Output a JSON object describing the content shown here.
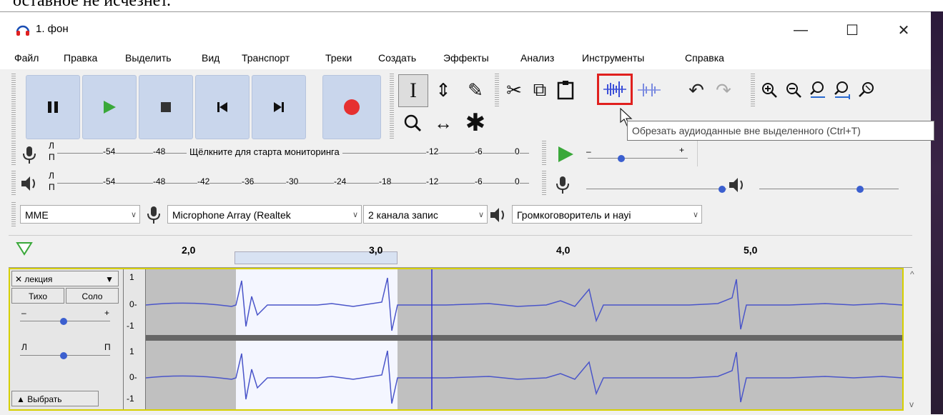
{
  "top_strip_text": "оставное не исчезнет.",
  "window": {
    "title": "1. фон",
    "minimize": "—",
    "maximize": "☐",
    "close": "✕"
  },
  "menu": [
    "Файл",
    "Правка",
    "Выделить",
    "Вид",
    "Транспорт",
    "Треки",
    "Создать",
    "Эффекты",
    "Анализ",
    "Инструменты",
    "Справка"
  ],
  "transport": {
    "pause": "pause-icon",
    "play": "play-icon",
    "stop": "stop-icon",
    "skip_start": "skip-start-icon",
    "skip_end": "skip-end-icon",
    "record": "record-icon"
  },
  "colors": {
    "accent_waveform": "#4a55c9",
    "highlight_box": "#e0201e",
    "record": "#e63030",
    "play": "#33aa33",
    "track_border": "#d6d000"
  },
  "tools": {
    "selection": "I",
    "envelope": "⇕",
    "draw": "✎",
    "zoom": "🔍",
    "timeshift": "↔",
    "multi": "✱"
  },
  "edit_tools": {
    "cut": "✂",
    "copy": "⧉",
    "paste": "📋",
    "trim": "trim-audio-icon",
    "silence": "silence-audio-icon",
    "undo": "↶",
    "redo": "↷"
  },
  "zoom_tools": [
    "⊕",
    "⊖",
    "zoom-sel",
    "zoom-fit",
    "zoom-toggle"
  ],
  "tooltip": "Обрезать аудиоданные вне выделенного (Ctrl+T)",
  "rec_meter": {
    "l": "Л",
    "r": "П",
    "ticks": [
      "-54",
      "-48",
      "-12",
      "-6",
      "0"
    ],
    "prompt": "Щёлкните для старта мониторинга"
  },
  "play_meter": {
    "l": "Л",
    "r": "П",
    "ticks": [
      "-54",
      "-48",
      "-42",
      "-36",
      "-30",
      "-24",
      "-18",
      "-12",
      "-6",
      "0"
    ]
  },
  "speed": {
    "minus": "–",
    "plus": "+"
  },
  "devices": {
    "host": "MME",
    "mic": "Microphone Array (Realtek",
    "channels": "2 канала запис",
    "speaker": "Громкоговоритель и науі"
  },
  "ruler": [
    "2,0",
    "3,0",
    "4,0",
    "5,0"
  ],
  "track": {
    "name": "лекция",
    "mute": "Тихо",
    "solo": "Соло",
    "gain_minus": "–",
    "gain_plus": "+",
    "pan_l": "Л",
    "pan_r": "П",
    "select": "Выбрать",
    "scale": [
      "1",
      "0-",
      "-1"
    ]
  }
}
